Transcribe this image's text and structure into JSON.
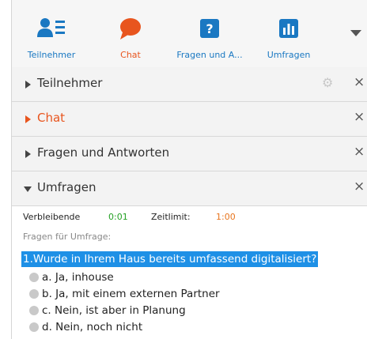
{
  "toolbar": {
    "items": [
      {
        "label": "Teilnehmer",
        "icon": "participants-icon"
      },
      {
        "label": "Chat",
        "icon": "chat-icon"
      },
      {
        "label": "Fragen und A...",
        "icon": "question-icon",
        "glyph": "?"
      },
      {
        "label": "Umfragen",
        "icon": "poll-icon"
      }
    ],
    "more_icon": "chevron-down-icon"
  },
  "panels": [
    {
      "label": "Teilnehmer",
      "expanded": false
    },
    {
      "label": "Chat",
      "expanded": false
    },
    {
      "label": "Fragen und Antworten",
      "expanded": false
    },
    {
      "label": "Umfragen",
      "expanded": true
    }
  ],
  "close_glyph": "×",
  "gear_glyph": "⚙",
  "poll": {
    "remaining_label": "Verbleibende",
    "remaining_value": "0:01",
    "limit_label": "Zeitlimit:",
    "limit_value": "1:00",
    "questions_heading": "Fragen für Umfrage:",
    "question": "1.Wurde in Ihrem Haus bereits umfassend digitalisiert?",
    "options": [
      "a. Ja, inhouse",
      "b. Ja, mit einem externen Partner",
      "c. Nein, ist aber in Planung",
      "d. Nein, noch nicht"
    ]
  },
  "colors": {
    "accent_blue": "#1a78c2",
    "active_orange": "#e8551e",
    "timer_green": "#25a125",
    "limit_orange": "#e8751e",
    "highlight": "#1e90e6"
  }
}
